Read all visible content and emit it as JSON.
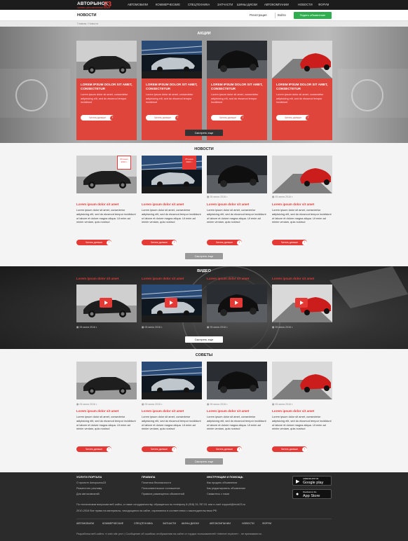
{
  "header": {
    "logo_top": "АВТОРЫНОК",
    "logo_sub": "СЕРВИС ДЛЯ АВТОЛЮБИТЕЛЕЙ",
    "logo_num": "23",
    "nav": [
      "АВТОМОБИЛИ",
      "КОММЕРЧЕСКИЕ",
      "СПЕЦТЕХНИКА",
      "ЗАПЧАСТИ",
      "ШИНЫ ДИСКИ",
      "АВТОКОМПАНИИ",
      "НОВОСТИ",
      "ФОРУМ"
    ]
  },
  "subbar": {
    "title": "НОВОСТИ",
    "register": "Регистрация",
    "login": "Войти",
    "add_button": "Подать объявление"
  },
  "breadcrumb": "Главная / Новости",
  "promo": {
    "title": "АКЦИИ",
    "cards": [
      {
        "title": "LOREM IPSUM DOLOR SIT AMET, CONSECTETUR",
        "text": "Lorem ipsum dolor sit amet, consectetur adipisicing elit, sed do eiusmod tempor incididunt",
        "button": "Читать дальше"
      },
      {
        "title": "LOREM IPSUM DOLOR SIT AMET, CONSECTETUR",
        "text": "Lorem ipsum dolor sit amet, consectetur adipisicing elit, sed do eiusmod tempor incididunt",
        "button": "Читать дальше"
      },
      {
        "title": "LOREM IPSUM DOLOR SIT AMET, CONSECTETUR",
        "text": "Lorem ipsum dolor sit amet, consectetur adipisicing elit, sed do eiusmod tempor incididunt",
        "button": "Читать дальше"
      },
      {
        "title": "LOREM IPSUM DOLOR SIT AMET, CONSECTETUR",
        "text": "Lorem ipsum dolor sit amet, consectetur adipisicing elit, sed do eiusmod tempor incididunt",
        "button": "Читать дальше"
      }
    ],
    "more": "Смотреть еще"
  },
  "news": {
    "title": "НОВОСТИ",
    "cards": [
      {
        "datebox": "05 июня 2016 г.",
        "date": "",
        "title": "Lorem ipsum dolor sit amet",
        "text": "Lorem ipsum dolor sit amet, consectetur adipisicing elit, sed do eiusmod tempor incididunt ut labore et dolore magna aliqua. Ut enim ad minim veniam, quis nostrud",
        "button": "Читать дальше"
      },
      {
        "datebox": "05 июня 2016 г.",
        "date": "",
        "title": "Lorem ipsum dolor sit amet",
        "text": "Lorem ipsum dolor sit amet, consectetur adipisicing elit, sed do eiusmod tempor incididunt ut labore et dolore magna aliqua. Ut enim ad minim veniam, quis nostrud",
        "button": "Читать дальше"
      },
      {
        "datebox": "",
        "date": "05 июня 2016 г.",
        "title": "Lorem ipsum dolor sit amet",
        "text": "Lorem ipsum dolor sit amet, consectetur adipisicing elit, sed do eiusmod tempor incididunt ut labore et dolore magna aliqua. Ut enim ad minim veniam, quis nostrud",
        "button": "Читать дальше"
      },
      {
        "datebox": "",
        "date": "05 июня 2016 г.",
        "title": "Lorem ipsum dolor sit amet",
        "text": "Lorem ipsum dolor sit amet, consectetur adipisicing elit, sed do eiusmod tempor incididunt ut labore et dolore magna aliqua. Ut enim ad minim veniam, quis nostrud",
        "button": "Читать дальше"
      }
    ],
    "more": "Смотреть еще"
  },
  "video": {
    "title": "ВИДЕО",
    "cards": [
      {
        "title": "Lorem ipsum dolor sit amet",
        "date": "05 июня 2016 г."
      },
      {
        "title": "Lorem ipsum dolor sit amet",
        "date": "05 июня 2016 г."
      },
      {
        "title": "Lorem ipsum dolor sit amet",
        "date": "05 июня 2016 г."
      },
      {
        "title": "Lorem ipsum dolor sit amet",
        "date": "05 июня 2016 г."
      }
    ],
    "more": "Смотреть еще"
  },
  "tips": {
    "title": "СОВЕТЫ",
    "cards": [
      {
        "date": "05 июня 2016 г.",
        "title": "Lorem ipsum dolor sit amet",
        "text": "Lorem ipsum dolor sit amet, consectetur adipisicing elit, sed do eiusmod tempor incididunt ut labore et dolore magna aliqua. Ut enim ad minim veniam, quis nostrud",
        "button": "Читать дальше"
      },
      {
        "date": "05 июня 2016 г.",
        "title": "Lorem ipsum dolor sit amet",
        "text": "Lorem ipsum dolor sit amet, consectetur adipisicing elit, sed do eiusmod tempor incididunt ut labore et dolore magna aliqua. Ut enim ad minim veniam, quis nostrud",
        "button": "Читать дальше"
      },
      {
        "date": "05 июня 2016 г.",
        "title": "Lorem ipsum dolor sit amet",
        "text": "Lorem ipsum dolor sit amet, consectetur adipisicing elit, sed do eiusmod tempor incididunt ut labore et dolore magna aliqua. Ut enim ad minim veniam, quis nostrud",
        "button": "Читать дальше"
      },
      {
        "date": "05 июня 2016 г.",
        "title": "Lorem ipsum dolor sit amet",
        "text": "Lorem ipsum dolor sit amet, consectetur adipisicing elit, sed do eiusmod tempor incididunt ut labore et dolore magna aliqua. Ut enim ad minim veniam, quis nostrud",
        "button": "Читать дальше"
      }
    ],
    "more": "Смотреть еще"
  },
  "footer": {
    "col1": {
      "heading": "УСЛУГИ ПОРТАЛА",
      "links": [
        "О проекте Авторынок23",
        "Разместить рекламу",
        "Для автокомпаний"
      ]
    },
    "col2": {
      "heading": "ПРАВИЛА",
      "links": [
        "Политика безопасности",
        "Пользовательское соглашение",
        "Правила размещения объявлений"
      ]
    },
    "col3": {
      "heading": "ИНСТРУКЦИИ И ПОМОЩЬ",
      "links": [
        "Как продать объявление",
        "Как редактировать объявление",
        "Свяжитесь с нами"
      ]
    },
    "google_top": "ANDROID APP ON",
    "google_name": "Google play",
    "apple_top": "Download on the",
    "apple_name": "App Store",
    "note1": "По техническим вопросам веб-сайта, а также сотрудничеству, обращаться по телефону 8 (918) 31-787-51 или e-mail: support@rinok23.ru",
    "note2": "2010-2016 Все права на материалы, находящиеся на сайте, охраняются в соответствии с законодательством РФ.",
    "nav": [
      "АВТОМОБИЛИ",
      "КОММЕРЧЕСКИЕ",
      "СПЕЦТЕХНИКА",
      "ЗАПЧАСТИ",
      "ШИНЫ ДИСКИ",
      "АВТОКОМПАНИИ",
      "НОВОСТИ",
      "ФОРУМ"
    ],
    "bottom": "Разработка веб-сайта: «i web site pro»  |  Сообщение об ошибках отображения на сайте от гордых пользователей «internet explorer» - не принимаются."
  }
}
